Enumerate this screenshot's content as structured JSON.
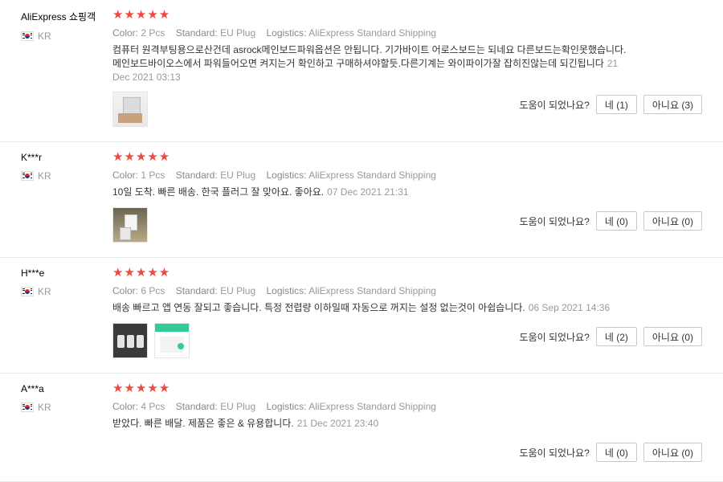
{
  "reviews": [
    {
      "user": "AliExpress 쇼핑객",
      "country": "KR",
      "stars": "★★★★★",
      "attrs": {
        "color_label": "Color:",
        "color": "2 Pcs",
        "standard_label": "Standard:",
        "standard": "EU Plug",
        "logistics_label": "Logistics:",
        "logistics": "AliExpress Standard Shipping"
      },
      "text": "컴퓨터 원격부팅용으로산건데 asrock메인보드파워옵션은 안됩니다. 기가바이트 어로스보드는 되네요 다른보드는확인못했습니다. 메인보드바이오스에서 파워들어오면 켜지는거 확인하고 구매하셔야할듯.다른기계는 와이파이가잘 잡히진않는데 되긴됩니다",
      "date": "21 Dec 2021 03:13",
      "helpful_q": "도움이 되었나요?",
      "yes": "네 (1)",
      "no": "아니요 (3)"
    },
    {
      "user": "K***r",
      "country": "KR",
      "stars": "★★★★★",
      "attrs": {
        "color_label": "Color:",
        "color": "1 Pcs",
        "standard_label": "Standard:",
        "standard": "EU Plug",
        "logistics_label": "Logistics:",
        "logistics": "AliExpress Standard Shipping"
      },
      "text": "10일 도착. 빠른 배송. 한국 플러그 잘 맞아요. 좋아요.",
      "date": "07 Dec 2021 21:31",
      "helpful_q": "도움이 되었나요?",
      "yes": "네 (0)",
      "no": "아니요 (0)"
    },
    {
      "user": "H***e",
      "country": "KR",
      "stars": "★★★★★",
      "attrs": {
        "color_label": "Color:",
        "color": "6 Pcs",
        "standard_label": "Standard:",
        "standard": "EU Plug",
        "logistics_label": "Logistics:",
        "logistics": "AliExpress Standard Shipping"
      },
      "text": "배송 빠르고 앱 연동 잘되고 좋습니다. 특정 전렵량 이하일때 자동으로 꺼지는 설정 없는것이 아쉽습니다.",
      "date": "06 Sep 2021 14:36",
      "helpful_q": "도움이 되었나요?",
      "yes": "네 (2)",
      "no": "아니요 (0)"
    },
    {
      "user": "A***a",
      "country": "KR",
      "stars": "★★★★★",
      "attrs": {
        "color_label": "Color:",
        "color": "4 Pcs",
        "standard_label": "Standard:",
        "standard": "EU Plug",
        "logistics_label": "Logistics:",
        "logistics": "AliExpress Standard Shipping"
      },
      "text": "받았다. 빠른 배달. 제품은 좋은 & 유용합니다.",
      "date": "21 Dec 2021 23:40",
      "helpful_q": "도움이 되었나요?",
      "yes": "네 (0)",
      "no": "아니요 (0)"
    }
  ],
  "colors": {
    "star": "#f0473f",
    "muted": "#999999",
    "border": "#e8e8e8"
  }
}
